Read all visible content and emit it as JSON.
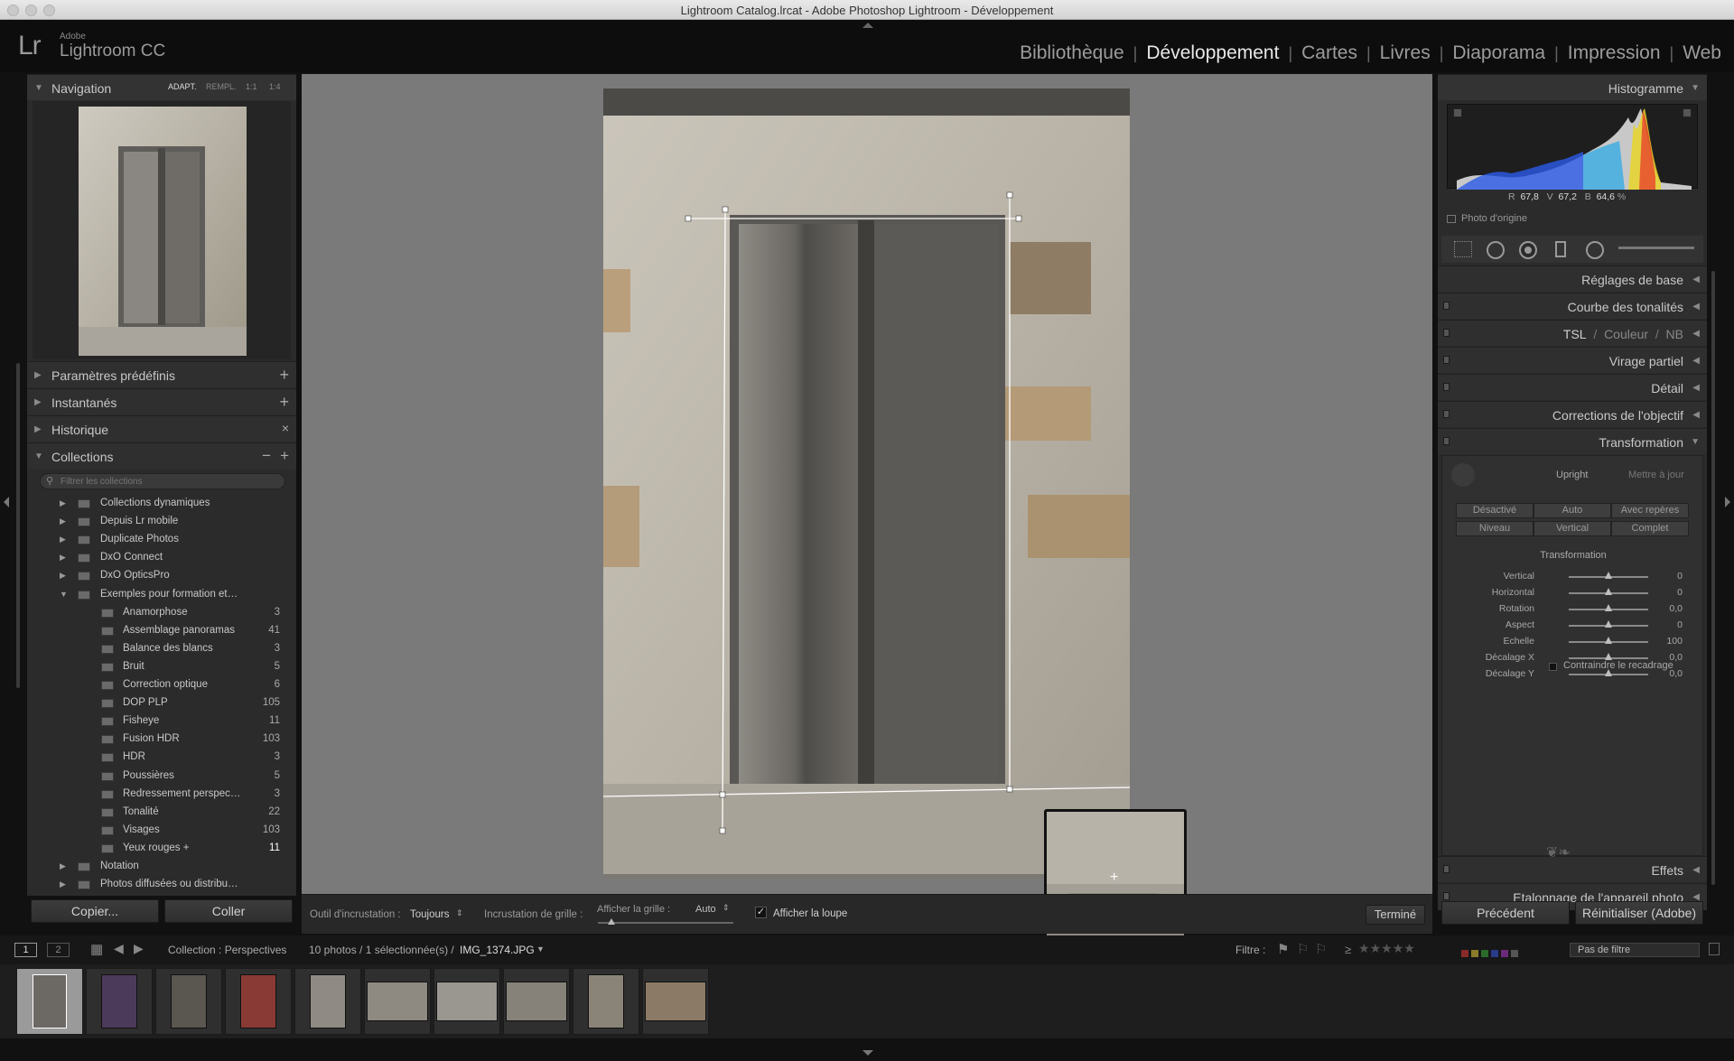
{
  "window": {
    "title": "Lightroom Catalog.lrcat - Adobe Photoshop Lightroom - Développement"
  },
  "app": {
    "logo": "Lr",
    "adobe": "Adobe",
    "name": "Lightroom CC"
  },
  "modules": [
    "Bibliothèque",
    "Développement",
    "Cartes",
    "Livres",
    "Diaporama",
    "Impression",
    "Web"
  ],
  "active_module": "Développement",
  "left_panel": {
    "navigation": {
      "title": "Navigation",
      "zoom_options": [
        "ADAPT.",
        "REMPL.",
        "1:1",
        "1:4"
      ]
    },
    "presets": "Paramètres prédéfinis",
    "snapshots": "Instantanés",
    "history": "Historique",
    "collections": {
      "title": "Collections",
      "filter_placeholder": "Filtrer les collections",
      "items": [
        {
          "label": "Collections dynamiques",
          "count": ""
        },
        {
          "label": "Depuis Lr mobile",
          "count": ""
        },
        {
          "label": "Duplicate Photos",
          "count": ""
        },
        {
          "label": "DxO Connect",
          "count": ""
        },
        {
          "label": "DxO OpticsPro",
          "count": ""
        },
        {
          "label": "Exemples pour formation et…",
          "count": ""
        },
        {
          "label": "Anamorphose",
          "count": "3"
        },
        {
          "label": "Assemblage panoramas",
          "count": "41"
        },
        {
          "label": "Balance des blancs",
          "count": "3"
        },
        {
          "label": "Bruit",
          "count": "5"
        },
        {
          "label": "Correction optique",
          "count": "6"
        },
        {
          "label": "DOP PLP",
          "count": "105"
        },
        {
          "label": "Fisheye",
          "count": "11"
        },
        {
          "label": "Fusion HDR",
          "count": "103"
        },
        {
          "label": "HDR",
          "count": "3"
        },
        {
          "label": "Poussières",
          "count": "5"
        },
        {
          "label": "Redressement perspec…",
          "count": "3"
        },
        {
          "label": "Tonalité",
          "count": "22"
        },
        {
          "label": "Visages",
          "count": "103"
        },
        {
          "label": "Yeux rouges +",
          "count": "11"
        },
        {
          "label": "Notation",
          "count": ""
        },
        {
          "label": "Photos diffusées ou distribu…",
          "count": ""
        }
      ]
    },
    "copy_button": "Copier...",
    "paste_button": "Coller"
  },
  "right_panel": {
    "histogram": {
      "title": "Histogramme",
      "r_label": "R",
      "r": "67,8",
      "g_label": "V",
      "g": "67,2",
      "b_label": "B",
      "b": "64,6",
      "unit": "%",
      "original": "Photo d'origine"
    },
    "panels": [
      "Réglages de base",
      "Courbe des tonalités"
    ],
    "tsl": {
      "a": "TSL",
      "b": "Couleur",
      "c": "NB",
      "sep": "/"
    },
    "panels2": [
      "Virage partiel",
      "Détail",
      "Corrections de l'objectif",
      "Transformation"
    ],
    "upright": {
      "label": "Upright",
      "update": "Mettre à jour",
      "buttons": [
        "Désactivé",
        "Auto",
        "Avec repères",
        "Niveau",
        "Vertical",
        "Complet"
      ]
    },
    "transform": {
      "title": "Transformation",
      "sliders": [
        {
          "label": "Vertical",
          "value": "0",
          "level": 0.5
        },
        {
          "label": "Horizontal",
          "value": "0",
          "level": 0.5
        },
        {
          "label": "Rotation",
          "value": "0,0",
          "level": 0.5
        },
        {
          "label": "Aspect",
          "value": "0",
          "level": 0.5
        },
        {
          "label": "Echelle",
          "value": "100",
          "level": 0.5
        },
        {
          "label": "Décalage X",
          "value": "0,0",
          "level": 0.5
        },
        {
          "label": "Décalage Y",
          "value": "0,0",
          "level": 0.5
        }
      ],
      "constrain": "Contraindre le recadrage"
    },
    "effects": "Effets",
    "calibration": "Etalonnage de l'appareil photo",
    "prev_button": "Précédent",
    "reset_button": "Réinitialiser (Adobe)"
  },
  "toolbar": {
    "overlay_label": "Outil d'incrustation :",
    "overlay_value": "Toujours",
    "grid_label": "Incrustation de grille :",
    "show_grid": "Afficher la grille :",
    "grid_value": "Auto",
    "loupe": "Afficher la loupe",
    "done": "Terminé"
  },
  "filmstrip_bar": {
    "screen1": "1",
    "screen2": "2",
    "source": "Collection : Perspectives",
    "count": "10 photos / 1 sélectionnée(s) /",
    "filename": "IMG_1374.JPG",
    "filter_label": "Filtre :",
    "rating_op": "≥",
    "filter_value": "Pas de filtre"
  },
  "colors": {
    "accent_histogram_red": "#e8302a",
    "accent_histogram_blue": "#2a5ae8",
    "accent_histogram_yellow": "#e8d52a",
    "panel_bg": "#2b2b2b",
    "center_bg": "#7a7a7a"
  }
}
